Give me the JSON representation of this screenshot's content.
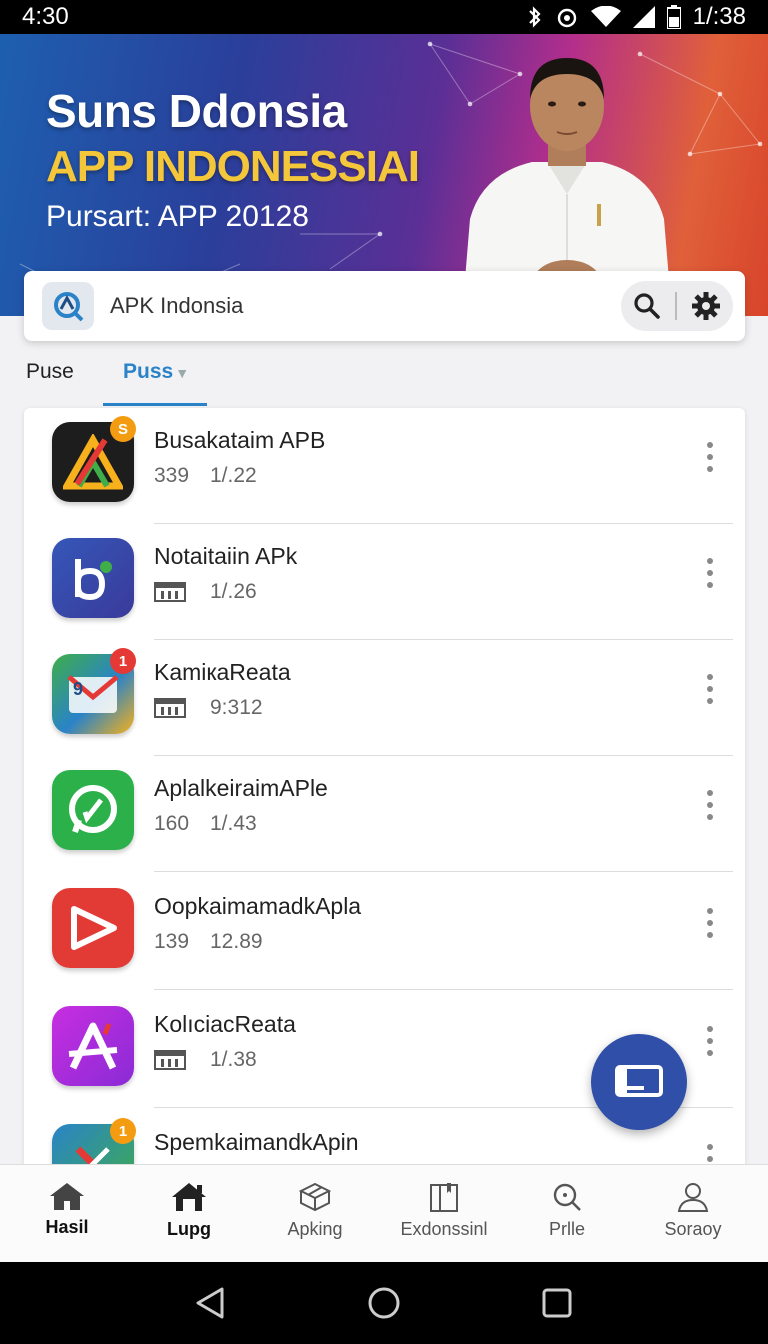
{
  "status_bar": {
    "time": "4:30",
    "right_time": "1/:38"
  },
  "banner": {
    "title": "Suns Ddonsia",
    "subtitle": "APP INDONESSIAI",
    "tagline": "Pursart: APP 20128"
  },
  "search": {
    "value": "APK Indonsia"
  },
  "tabs": [
    {
      "label": "Puse",
      "active": false
    },
    {
      "label": "Puss",
      "active": true
    }
  ],
  "apps": [
    {
      "name": "Busakataim APB",
      "meta1": "339",
      "meta2": "1/.22",
      "badge": "S"
    },
    {
      "name": "Notaitaiin APk",
      "meta1": "",
      "meta2": "1/.26",
      "badge": ""
    },
    {
      "name": "KamiкaReata",
      "meta1": "",
      "meta2": "9:312",
      "badge": "1"
    },
    {
      "name": "AplalkeiraimAPle",
      "meta1": "160",
      "meta2": "1/.43",
      "badge": ""
    },
    {
      "name": "OopkaimamadkApla",
      "meta1": "139",
      "meta2": "12.89",
      "badge": ""
    },
    {
      "name": "KolıciacReata",
      "meta1": "",
      "meta2": "1/.38",
      "badge": ""
    },
    {
      "name": "SpemkaimandkApin",
      "meta1": "",
      "meta2": "",
      "badge": "1"
    }
  ],
  "bottom_nav": [
    {
      "label": "Hasil",
      "icon": "home-icon",
      "active": true
    },
    {
      "label": "Lupg",
      "icon": "home-outline-icon",
      "active": true
    },
    {
      "label": "Apking",
      "icon": "box-icon",
      "active": false
    },
    {
      "label": "Exdonssinl",
      "icon": "book-icon",
      "active": false
    },
    {
      "label": "Prlle",
      "icon": "search-icon",
      "active": false
    },
    {
      "label": "Soraoy",
      "icon": "person-icon",
      "active": false
    }
  ],
  "colors": {
    "accent": "#2a83c8",
    "fab": "#2f4fa8",
    "banner_yellow": "#f4c63a"
  }
}
